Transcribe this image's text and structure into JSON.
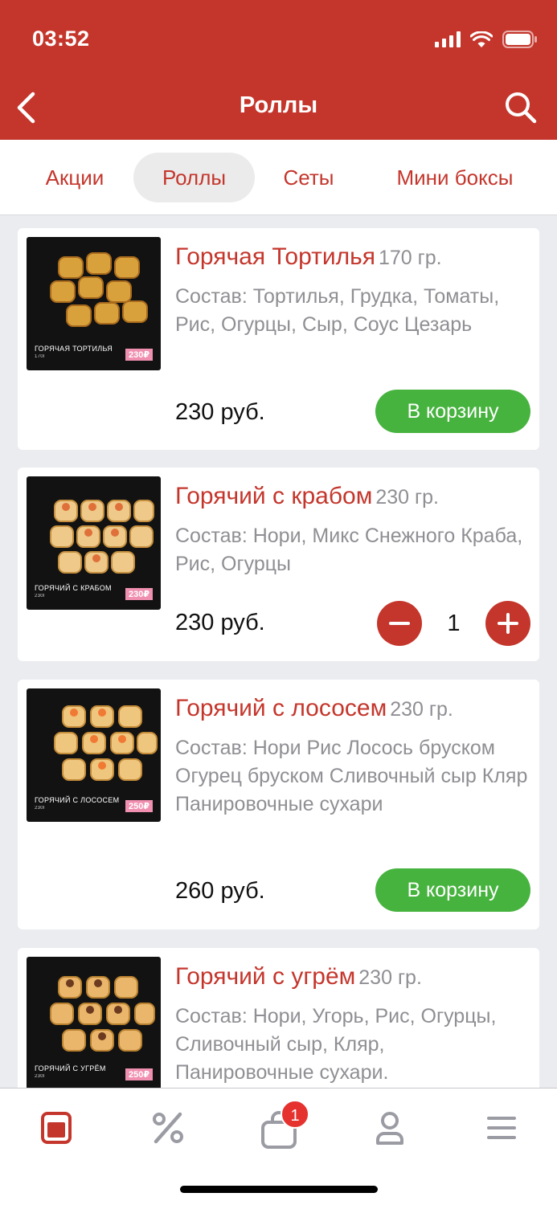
{
  "status": {
    "time": "03:52"
  },
  "header": {
    "title": "Роллы"
  },
  "tabs": [
    "Акции",
    "Роллы",
    "Сеты",
    "Мини боксы"
  ],
  "products": [
    {
      "name": "Горячая Тортилья",
      "weight": "170 гр.",
      "description": "Состав: Тортилья, Грудка, Томаты, Рис, Огурцы, Сыр, Соус Цезарь",
      "price": "230 руб.",
      "action": "В корзину",
      "image_label": "ГОРЯЧАЯ ТОРТИЛЬЯ",
      "image_sub": "170г",
      "image_price": "230₽"
    },
    {
      "name": "Горячий с крабом",
      "weight": "230 гр.",
      "description": "Состав: Нори, Микс Снежного Краба, Рис, Огурцы",
      "price": "230 руб.",
      "quantity": "1",
      "image_label": "ГОРЯЧИЙ С КРАБОМ",
      "image_sub": "230г",
      "image_price": "230₽"
    },
    {
      "name": "Горячий с лососем",
      "weight": "230 гр.",
      "description": "Состав: Нори Рис Лосось бруском Огурец бруском Сливочный сыр Кляр Панировочные сухари",
      "price": "260 руб.",
      "action": "В корзину",
      "image_label": "ГОРЯЧИЙ С ЛОСОСЕМ",
      "image_sub": "230г",
      "image_price": "250₽"
    },
    {
      "name": "Горячий с угрём",
      "weight": "230 гр.",
      "description": "Состав: Нори, Угорь, Рис, Огурцы, Сливочный сыр, Кляр, Панировочные сухари.",
      "image_label": "ГОРЯЧИЙ С УГРЁМ",
      "image_sub": "230г",
      "image_price": "250₽"
    }
  ],
  "tabbar": {
    "cart_badge": "1"
  },
  "colors": {
    "brand": "#c4362c",
    "accent_green": "#47b33f",
    "muted": "#8f8f94"
  }
}
